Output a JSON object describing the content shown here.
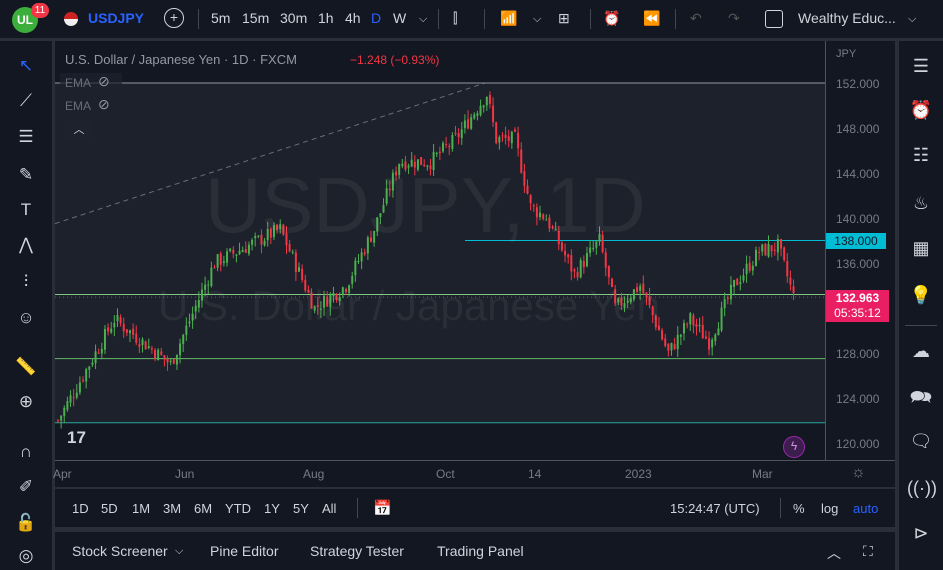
{
  "topbar": {
    "notifications": "11",
    "symbol": "USDJPY",
    "intervals": [
      "5m",
      "15m",
      "30m",
      "1h",
      "4h",
      "D",
      "W"
    ],
    "active_interval": "D",
    "layout_name": "Wealthy Educ..."
  },
  "legend": {
    "title": "U.S. Dollar / Japanese Yen · 1D · FXCM",
    "change": "−1.248 (−0.93%)",
    "indicators": [
      "EMA",
      "EMA"
    ]
  },
  "watermark": {
    "symbol": "USDJPY, 1D",
    "name": "U.S. Dollar / Japanese Yen"
  },
  "price_axis": {
    "currency": "JPY",
    "ticks": [
      "152.000",
      "148.000",
      "144.000",
      "140.000",
      "136.000",
      "128.000",
      "124.000",
      "120.000"
    ],
    "level_label": "138.000",
    "last_price": "132.963",
    "countdown": "05:35:12"
  },
  "time_axis": {
    "ticks": [
      "Apr",
      "Jun",
      "Aug",
      "Oct",
      "14",
      "2023",
      "Mar"
    ]
  },
  "bottombar": {
    "ranges": [
      "1D",
      "5D",
      "1M",
      "3M",
      "6M",
      "YTD",
      "1Y",
      "5Y",
      "All"
    ],
    "clock": "15:24:47 (UTC)",
    "percent": "%",
    "log": "log",
    "auto": "auto"
  },
  "panel": {
    "tabs": [
      "Stock Screener",
      "Pine Editor",
      "Strategy Tester",
      "Trading Panel"
    ]
  },
  "colors": {
    "up": "#4caf50",
    "down": "#f23645",
    "accent": "#2962ff",
    "cyan": "#00bcd4",
    "last": "#e91e63"
  },
  "chart_data": {
    "type": "candlestick",
    "symbol": "USDJPY",
    "ylim": [
      118,
      154
    ],
    "horizontal_levels": [
      152.0,
      138.0,
      133.2,
      127.5,
      121.8
    ],
    "approx_close_path": [
      [
        0,
        122
      ],
      [
        18,
        131
      ],
      [
        36,
        127
      ],
      [
        50,
        136
      ],
      [
        71,
        139
      ],
      [
        82,
        132
      ],
      [
        92,
        134
      ],
      [
        101,
        139
      ],
      [
        109,
        145
      ],
      [
        119,
        145
      ],
      [
        127,
        147
      ],
      [
        137,
        151
      ],
      [
        140,
        147
      ],
      [
        146,
        147
      ],
      [
        151,
        141
      ],
      [
        156,
        140
      ],
      [
        165,
        135
      ],
      [
        173,
        138
      ],
      [
        178,
        132
      ],
      [
        186,
        134
      ],
      [
        195,
        128
      ],
      [
        202,
        131
      ],
      [
        208,
        129
      ],
      [
        216,
        134
      ],
      [
        224,
        137
      ],
      [
        230,
        137.5
      ],
      [
        235,
        133
      ]
    ]
  }
}
